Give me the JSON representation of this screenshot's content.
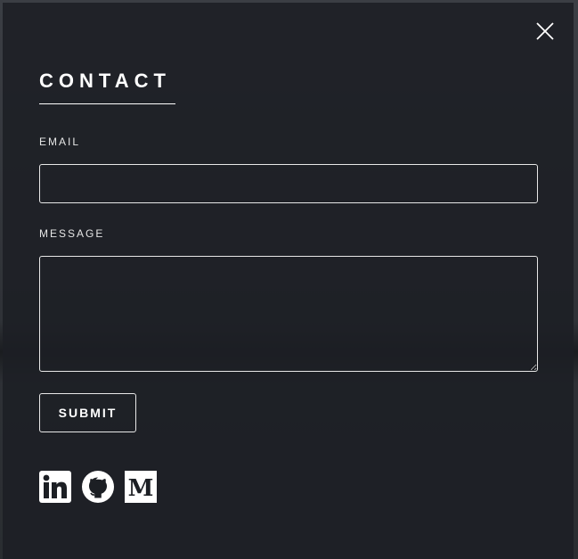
{
  "contact": {
    "title": "CONTACT",
    "email_label": "EMAIL",
    "email_value": "",
    "message_label": "MESSAGE",
    "message_value": "",
    "submit_label": "SUBMIT"
  },
  "social": {
    "icons": [
      "linkedin-icon",
      "github-icon",
      "medium-icon"
    ],
    "medium_letter": "M"
  },
  "colors": {
    "panel": "#1c1f24",
    "border": "#e8e8e8",
    "text": "#ffffff"
  }
}
